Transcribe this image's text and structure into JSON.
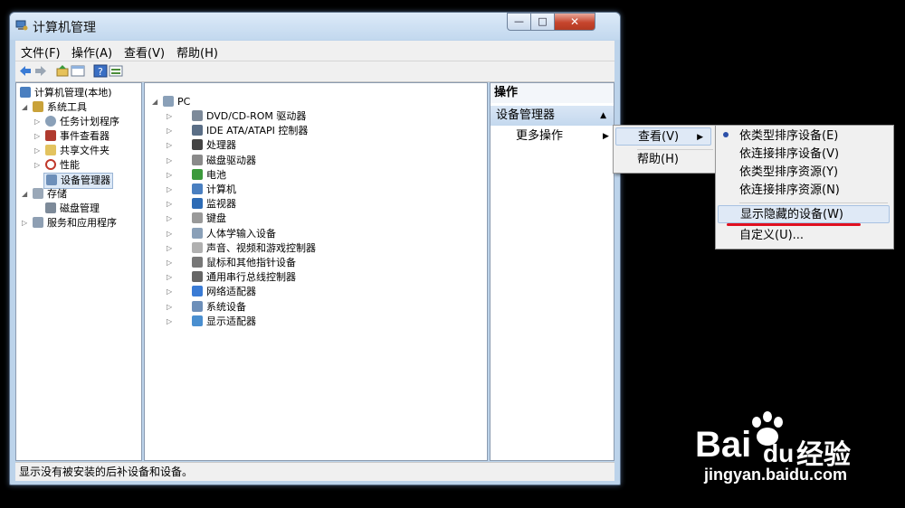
{
  "window": {
    "title": "计算机管理"
  },
  "controls": {
    "min": "—",
    "max": "□",
    "close": "✕"
  },
  "menubar": [
    "文件(F)",
    "操作(A)",
    "查看(V)",
    "帮助(H)"
  ],
  "left_tree": [
    {
      "label": "计算机管理(本地)",
      "icon": "computer-icon"
    },
    {
      "label": "系统工具",
      "icon": "tools-icon"
    },
    {
      "label": "任务计划程序",
      "icon": "clock-icon"
    },
    {
      "label": "事件查看器",
      "icon": "event-icon"
    },
    {
      "label": "共享文件夹",
      "icon": "folder-icon"
    },
    {
      "label": "性能",
      "icon": "performance-icon"
    },
    {
      "label": "设备管理器",
      "icon": "device-manager-icon"
    },
    {
      "label": "存储",
      "icon": "storage-icon"
    },
    {
      "label": "磁盘管理",
      "icon": "disk-icon"
    },
    {
      "label": "服务和应用程序",
      "icon": "services-icon"
    }
  ],
  "device_tree": {
    "root": "PC",
    "items": [
      "DVD/CD-ROM 驱动器",
      "IDE ATA/ATAPI 控制器",
      "处理器",
      "磁盘驱动器",
      "电池",
      "计算机",
      "监视器",
      "键盘",
      "人体学输入设备",
      "声音、视频和游戏控制器",
      "鼠标和其他指针设备",
      "通用串行总线控制器",
      "网络适配器",
      "系统设备",
      "显示适配器"
    ]
  },
  "actions": {
    "header": "操作",
    "section": "设备管理器",
    "more": "更多操作"
  },
  "popup1": {
    "view": "查看(V)",
    "help": "帮助(H)"
  },
  "popup2": {
    "items": [
      "依类型排序设备(E)",
      "依连接排序设备(V)",
      "依类型排序资源(Y)",
      "依连接排序资源(N)",
      "显示隐藏的设备(W)",
      "自定义(U)..."
    ]
  },
  "status": "显示没有被安装的后补设备和设备。",
  "watermark": {
    "brand_a": "Bai",
    "brand_b": "du",
    "brand_c": "经验",
    "url": "jingyan.baidu.com"
  },
  "colors": {
    "highlight_line": "#e01020",
    "window_frame": "#bcd3ea"
  }
}
